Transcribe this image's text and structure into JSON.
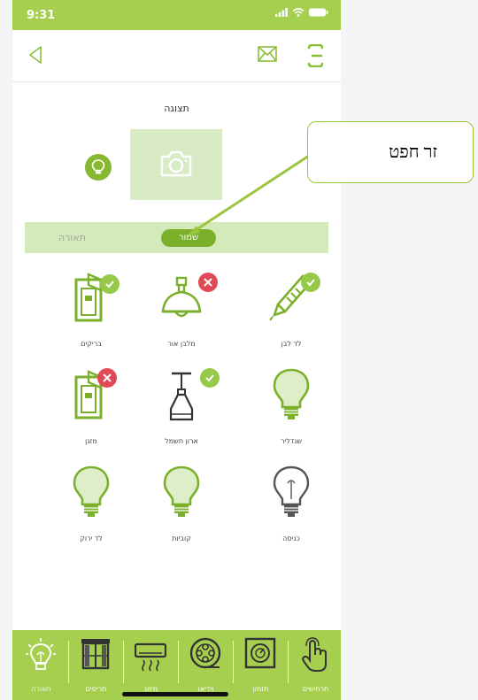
{
  "status": {
    "time": "9:31"
  },
  "display": {
    "title": "תצוגה"
  },
  "lighting_bar": {
    "label": "תאורה",
    "save_label": "שמור"
  },
  "devices": [
    {
      "label": "בריקים",
      "status": "ok",
      "icon": "switch-icon"
    },
    {
      "label": "מלבן אור",
      "status": "off",
      "icon": "pendant-lamp-icon"
    },
    {
      "label": "לד לבן",
      "status": "ok",
      "icon": "led-strip-icon"
    },
    {
      "label": "מזגן",
      "status": "off",
      "icon": "switch-icon"
    },
    {
      "label": "ארון חשמל",
      "status": "ok",
      "icon": "hanging-lamp-icon"
    },
    {
      "label": "שנדליר",
      "status": "none",
      "icon": "bulb-icon"
    },
    {
      "label": "לד ירוק",
      "status": "none",
      "icon": "bulb-icon"
    },
    {
      "label": "קוביות",
      "status": "none",
      "icon": "bulb-icon"
    },
    {
      "label": "כניסה",
      "status": "none",
      "icon": "bulb-gray-icon"
    }
  ],
  "tabs": [
    {
      "label": "תאורה",
      "icon": "lightbulb-icon"
    },
    {
      "label": "תריסים",
      "icon": "window-icon"
    },
    {
      "label": "מיזוג",
      "icon": "air-conditioner-icon"
    },
    {
      "label": "וידיאו",
      "icon": "film-reel-icon"
    },
    {
      "label": "תזמון",
      "icon": "timer-icon"
    },
    {
      "label": "תרחישים",
      "icon": "touch-icon"
    }
  ],
  "callout": {
    "text": "זר חפט"
  },
  "colors": {
    "accent": "#a6cf4f",
    "dark_green": "#7ab02a",
    "error": "#e04a57",
    "light_green": "#d4eabb"
  }
}
